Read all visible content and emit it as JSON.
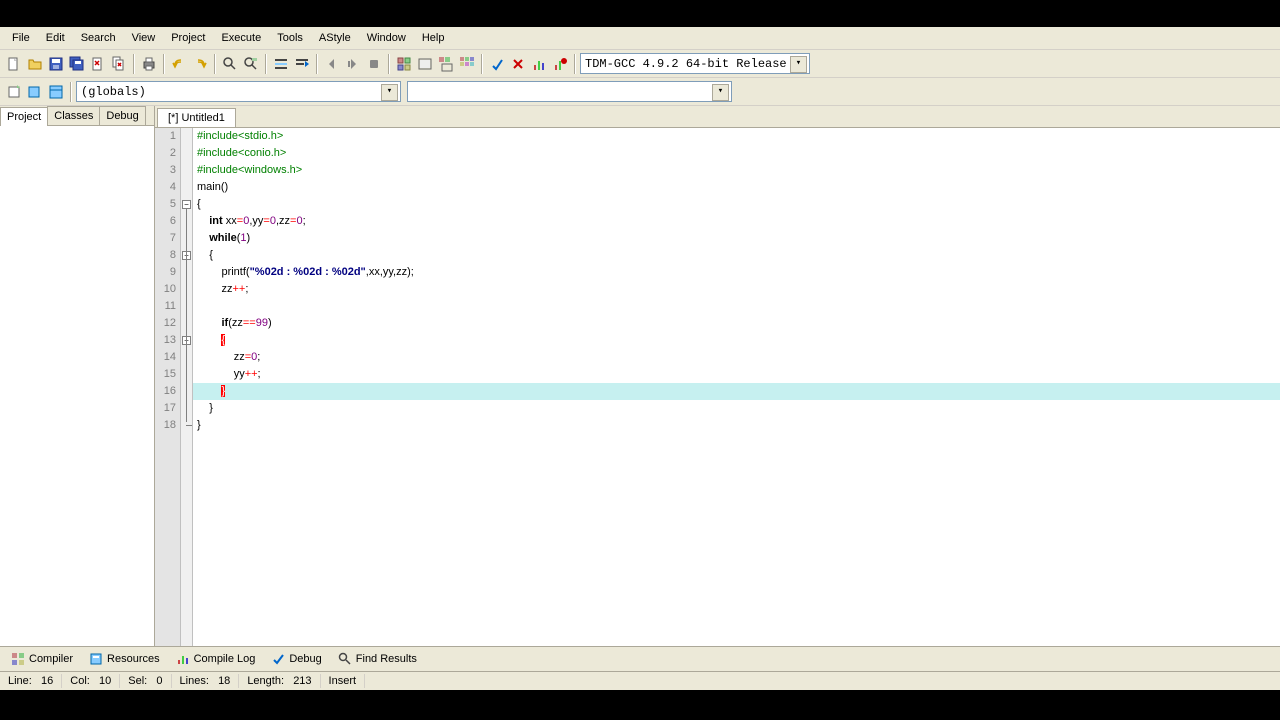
{
  "menu": {
    "items": [
      "File",
      "Edit",
      "Search",
      "View",
      "Project",
      "Execute",
      "Tools",
      "AStyle",
      "Window",
      "Help"
    ]
  },
  "toolbar2": {
    "scope_combo": "(globals)",
    "fn_combo": ""
  },
  "compiler_combo": "TDM-GCC 4.9.2 64-bit Release",
  "sidepanel": {
    "tabs": [
      "Project",
      "Classes",
      "Debug"
    ],
    "active": 0
  },
  "filetab": "[*] Untitled1",
  "code": {
    "lines": [
      {
        "n": 1,
        "tokens": [
          [
            "pp",
            "#include"
          ],
          [
            "pp",
            "<stdio.h>"
          ]
        ],
        "indent": 0
      },
      {
        "n": 2,
        "tokens": [
          [
            "pp",
            "#include"
          ],
          [
            "pp",
            "<conio.h>"
          ]
        ],
        "indent": 0
      },
      {
        "n": 3,
        "tokens": [
          [
            "pp",
            "#include"
          ],
          [
            "pp",
            "<windows.h>"
          ]
        ],
        "indent": 0
      },
      {
        "n": 4,
        "tokens": [
          [
            "txt",
            "main"
          ],
          [
            "txt",
            "()"
          ]
        ],
        "indent": 0
      },
      {
        "n": 5,
        "tokens": [
          [
            "txt",
            "{"
          ]
        ],
        "indent": 0,
        "fold": true
      },
      {
        "n": 6,
        "tokens": [
          [
            "kw",
            "int"
          ],
          [
            "txt",
            " xx"
          ],
          [
            "op",
            "="
          ],
          [
            "num",
            "0"
          ],
          [
            "txt",
            ",yy"
          ],
          [
            "op",
            "="
          ],
          [
            "num",
            "0"
          ],
          [
            "txt",
            ",zz"
          ],
          [
            "op",
            "="
          ],
          [
            "num",
            "0"
          ],
          [
            "txt",
            ";"
          ]
        ],
        "indent": 1
      },
      {
        "n": 7,
        "tokens": [
          [
            "kw",
            "while"
          ],
          [
            "txt",
            "("
          ],
          [
            "num",
            "1"
          ],
          [
            "txt",
            ")"
          ]
        ],
        "indent": 1
      },
      {
        "n": 8,
        "tokens": [
          [
            "txt",
            "{"
          ]
        ],
        "indent": 1,
        "fold": true
      },
      {
        "n": 9,
        "tokens": [
          [
            "txt",
            "printf("
          ],
          [
            "str",
            "\"%02d : %02d : %02d\""
          ],
          [
            "txt",
            ",xx,yy,zz);"
          ]
        ],
        "indent": 2
      },
      {
        "n": 10,
        "tokens": [
          [
            "txt",
            "zz"
          ],
          [
            "op",
            "++"
          ],
          [
            "txt",
            ";"
          ]
        ],
        "indent": 2
      },
      {
        "n": 11,
        "tokens": [],
        "indent": 2
      },
      {
        "n": 12,
        "tokens": [
          [
            "kw",
            "if"
          ],
          [
            "txt",
            "(zz"
          ],
          [
            "op",
            "=="
          ],
          [
            "num",
            "99"
          ],
          [
            "txt",
            ")"
          ]
        ],
        "indent": 2
      },
      {
        "n": 13,
        "tokens": [
          [
            "brace-match",
            "{"
          ]
        ],
        "indent": 2,
        "fold": true
      },
      {
        "n": 14,
        "tokens": [
          [
            "txt",
            "zz"
          ],
          [
            "op",
            "="
          ],
          [
            "num",
            "0"
          ],
          [
            "txt",
            ";"
          ]
        ],
        "indent": 3
      },
      {
        "n": 15,
        "tokens": [
          [
            "txt",
            "yy"
          ],
          [
            "op",
            "++"
          ],
          [
            "txt",
            ";"
          ]
        ],
        "indent": 3
      },
      {
        "n": 16,
        "tokens": [
          [
            "brace-match",
            "}"
          ]
        ],
        "indent": 2,
        "hl": true,
        "caret": true
      },
      {
        "n": 17,
        "tokens": [
          [
            "txt",
            "}"
          ]
        ],
        "indent": 1
      },
      {
        "n": 18,
        "tokens": [
          [
            "txt",
            "}"
          ]
        ],
        "indent": 0,
        "foldend": true
      }
    ]
  },
  "bottom_tabs": [
    {
      "label": "Compiler",
      "icon": "grid"
    },
    {
      "label": "Resources",
      "icon": "res"
    },
    {
      "label": "Compile Log",
      "icon": "log"
    },
    {
      "label": "Debug",
      "icon": "check"
    },
    {
      "label": "Find Results",
      "icon": "find"
    }
  ],
  "status": {
    "line_lbl": "Line:",
    "line_val": "16",
    "col_lbl": "Col:",
    "col_val": "10",
    "sel_lbl": "Sel:",
    "sel_val": "0",
    "lines_lbl": "Lines:",
    "lines_val": "18",
    "length_lbl": "Length:",
    "length_val": "213",
    "mode": "Insert"
  }
}
